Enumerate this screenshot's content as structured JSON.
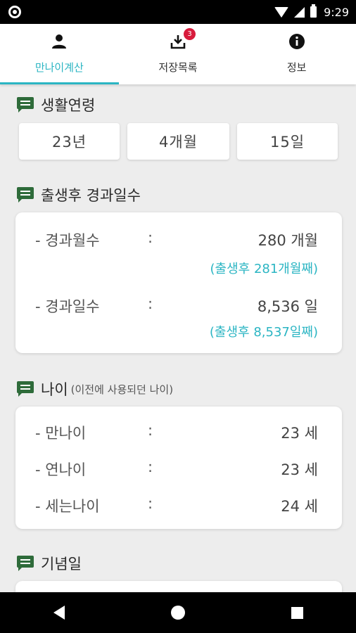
{
  "status": {
    "time": "9:29"
  },
  "tabs": [
    {
      "label": "만나이계산",
      "active": true,
      "icon": "person-icon"
    },
    {
      "label": "저장목록",
      "active": false,
      "icon": "download-icon",
      "badge": "3"
    },
    {
      "label": "정보",
      "active": false,
      "icon": "info-icon"
    }
  ],
  "living_age": {
    "title": "생활연령",
    "years": "23년",
    "months": "4개월",
    "days": "15일"
  },
  "elapsed": {
    "title": "출생후 경과일수",
    "months_label": "- 경과월수",
    "months_value": "280 개월",
    "months_note": "(출생후 281개월째)",
    "days_label": "- 경과일수",
    "days_value": "8,536 일",
    "days_note": "(출생후 8,537일째)",
    "colon": ":"
  },
  "ages": {
    "title": "나이",
    "subtitle": "(이전에 사용되던 나이)",
    "rows": [
      {
        "label": "- 만나이",
        "value": "23 세"
      },
      {
        "label": "- 연나이",
        "value": "23 세"
      },
      {
        "label": "- 세는나이",
        "value": "24 세"
      }
    ],
    "colon": ":"
  },
  "anniversary": {
    "title": "기념일"
  },
  "colors": {
    "accent": "#2bb5c3",
    "icon_green": "#2e6b3a",
    "badge": "#d81b3c"
  }
}
